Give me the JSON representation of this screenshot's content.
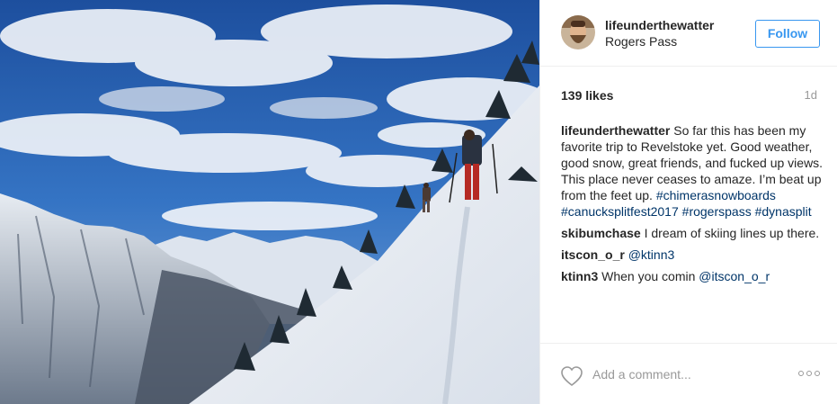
{
  "post": {
    "username": "lifeunderthewatter",
    "location": "Rogers Pass",
    "follow_label": "Follow",
    "likes": "139 likes",
    "time_ago": "1d",
    "caption": {
      "text": "So far this has been my favorite trip to Revelstoke yet. Good weather, good snow, great friends, and fucked up views. This place never ceases to amaze. I’m beat up from the feet up.",
      "hashtags": [
        "#chimerasnowboards",
        "#canucksplitfest2017",
        "#rogerspass",
        "#dynasplit"
      ]
    },
    "comments": [
      {
        "user": "skibumchase",
        "text": "I dream of skiing lines up there."
      },
      {
        "user": "itscon_o_r",
        "mention": "@ktinn3"
      },
      {
        "user": "ktinn3",
        "text": "When you comin",
        "mention": "@itscon_o_r"
      }
    ],
    "add_comment_placeholder": "Add a comment...",
    "icons": {
      "like": "heart-outline-icon",
      "more": "more-options-icon"
    }
  },
  "colors": {
    "follow": "#3897f0",
    "hashtag": "#003569",
    "muted": "#999999",
    "text": "#262626",
    "border": "#efefef"
  }
}
